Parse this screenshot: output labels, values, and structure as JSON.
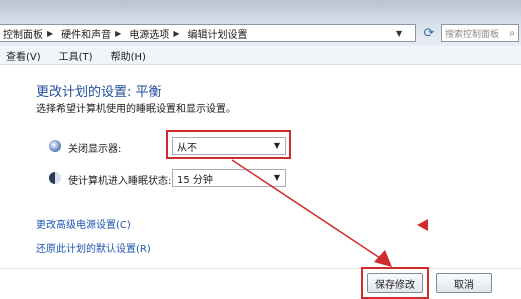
{
  "breadcrumb": {
    "items": [
      "控制面板",
      "硬件和声音",
      "电源选项",
      "编辑计划设置"
    ]
  },
  "search": {
    "placeholder": "搜索控制面板"
  },
  "menu": {
    "items": [
      "查看(V)",
      "工具(T)",
      "帮助(H)"
    ]
  },
  "page": {
    "title": "更改计划的设置: 平衡",
    "subtitle": "选择希望计算机使用的睡眠设置和显示设置。"
  },
  "settings": {
    "display_label": "关闭显示器:",
    "display_value": "从不",
    "sleep_label": "使计算机进入睡眠状态:",
    "sleep_value": "15 分钟"
  },
  "links": {
    "advanced": "更改高级电源设置(C)",
    "restore": "还原此计划的默认设置(R)"
  },
  "buttons": {
    "save": "保存修改",
    "cancel": "取消"
  },
  "annotations": {
    "accent_color": "#d12c2c"
  }
}
